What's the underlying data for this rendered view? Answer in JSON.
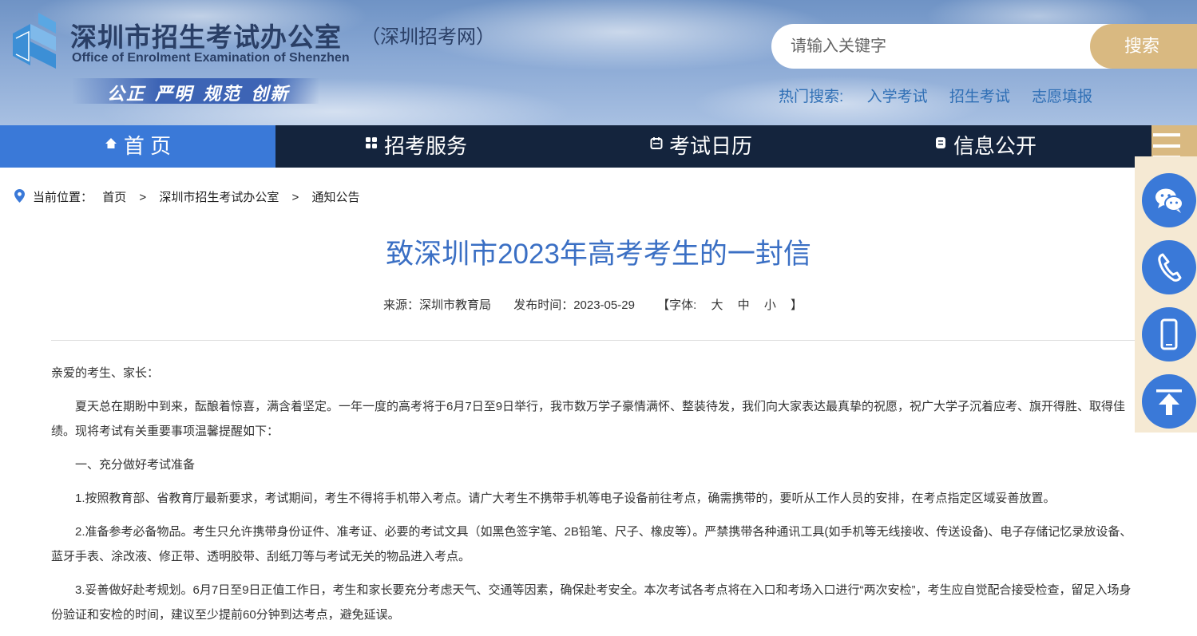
{
  "header": {
    "title": "深圳市招生考试办公室",
    "subtitle": "（深圳招考网）",
    "english": "Office of Enrolment Examination of Shenzhen",
    "slogan": "公正 严明 规范 创新",
    "search_placeholder": "请输入关键字",
    "search_button": "搜索",
    "hot_label": "热门搜索:",
    "hot_links": [
      "入学考试",
      "招生考试",
      "志愿填报"
    ]
  },
  "nav": {
    "items": [
      {
        "label": "首 页",
        "icon": "home-icon"
      },
      {
        "label": "招考服务",
        "icon": "grid-icon"
      },
      {
        "label": "考试日历",
        "icon": "calendar-icon"
      },
      {
        "label": "信息公开",
        "icon": "document-icon"
      }
    ],
    "menu_icon": "hamburger-menu-icon"
  },
  "breadcrumb": {
    "label": "当前位置：",
    "items": [
      "首页",
      "深圳市招生考试办公室",
      "通知公告"
    ],
    "separator": ">"
  },
  "article": {
    "title": "致深圳市2023年高考考生的一封信",
    "source": "来源：深圳市教育局",
    "date": "发布时间：2023-05-29",
    "font_label": "【字体:",
    "font_sizes": [
      "大",
      "中",
      "小"
    ],
    "font_close": "】",
    "paragraphs": [
      "亲爱的考生、家长：",
      "夏天总在期盼中到来，酝酿着惊喜，满含着坚定。一年一度的高考将于6月7日至9日举行，我市数万学子豪情满怀、整装待发，我们向大家表达最真挚的祝愿，祝广大学子沉着应考、旗开得胜、取得佳绩。现将考试有关重要事项温馨提醒如下：",
      "一、充分做好考试准备",
      "1.按照教育部、省教育厅最新要求，考试期间，考生不得将手机带入考点。请广大考生不携带手机等电子设备前往考点，确需携带的，要听从工作人员的安排，在考点指定区域妥善放置。",
      "2.准备参考必备物品。考生只允许携带身份证件、准考证、必要的考试文具（如黑色签字笔、2B铅笔、尺子、橡皮等）。严禁携带各种通讯工具(如手机等无线接收、传送设备)、电子存储记忆录放设备、蓝牙手表、涂改液、修正带、透明胶带、刮纸刀等与考试无关的物品进入考点。",
      "3.妥善做好赴考规划。6月7日至9日正值工作日，考生和家长要充分考虑天气、交通等因素，确保赴考安全。本次考试各考点将在入口和考场入口进行“两次安检”，考生应自觉配合接受检查，留足入场身份验证和安检的时间，建议至少提前60分钟到达考点，避免延误。"
    ]
  },
  "side_buttons": [
    {
      "name": "wechat-button",
      "icon": "wechat-icon"
    },
    {
      "name": "phone-button",
      "icon": "phone-icon"
    },
    {
      "name": "mobile-button",
      "icon": "mobile-icon"
    },
    {
      "name": "back-to-top-button",
      "icon": "arrow-up-icon"
    }
  ],
  "colors": {
    "nav_bg": "#14243d",
    "nav_active": "#3a79d8",
    "accent_gold": "#d9b981",
    "title_blue": "#3a6fc4",
    "link_blue": "#2f6fb5"
  }
}
